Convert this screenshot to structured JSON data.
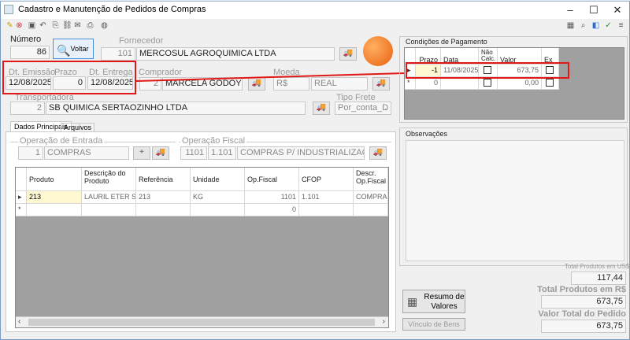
{
  "window": {
    "title": "Cadastro e Manutenção de Pedidos de Compras",
    "min": "–",
    "max": "☐",
    "close": "✕"
  },
  "header": {
    "numero_label": "Número",
    "numero_value": "86",
    "voltar_label": "Voltar",
    "fornecedor_label": "Fornecedor",
    "fornecedor_code": "101",
    "fornecedor_name": "MERCOSUL AGROQUIMICA LTDA",
    "dt_emissao_label": "Dt. Emissão",
    "dt_emissao_value": "12/08/2025",
    "prazo_label": "Prazo",
    "prazo_value": "0",
    "dt_entrega_label": "Dt. Entrega",
    "dt_entrega_value": "12/08/2025",
    "comprador_label": "Comprador",
    "comprador_code": "2",
    "comprador_name": "MARCELA GODOY",
    "moeda_label": "Moeda",
    "moeda_code": "R$",
    "moeda_name": "REAL",
    "transportadora_label": "Transportadora",
    "transportadora_code": "2",
    "transportadora_name": "SB QUIMICA SERTAOZINHO LTDA",
    "tipo_frete_label": "Tipo Frete",
    "tipo_frete_value": "Por_conta_D"
  },
  "tabs": [
    {
      "label": "Dados Principais"
    },
    {
      "label": "Arquivos"
    }
  ],
  "operacoes": {
    "entrada_label": "Operação de Entrada",
    "entrada_code": "1",
    "entrada_name": "COMPRAS",
    "fiscal_label": "Operação Fiscal",
    "fiscal_code": "1101",
    "fiscal_num": "1.101",
    "fiscal_name": "COMPRAS P/ INDUSTRIALIZACAO"
  },
  "items_grid": {
    "headers": [
      "Produto",
      "Descrição do Produto",
      "Referência",
      "Unidade",
      "Op.Fiscal",
      "CFOP",
      "Descr. Op.Fiscal"
    ],
    "rows": [
      [
        "213",
        "LAURIL ETER S...",
        "213",
        "KG",
        "1101",
        "1.101",
        "COMPRAS P..."
      ],
      [
        "",
        "",
        "",
        "",
        "0",
        "",
        ""
      ]
    ]
  },
  "pagamento": {
    "title": "Condições de Pagamento",
    "headers": [
      "Prazo",
      "Data",
      "Não Calc.",
      "Valor",
      "Ex"
    ],
    "rows": [
      [
        "-1",
        "11/08/2025",
        "",
        "673,75",
        ""
      ],
      [
        "0",
        "",
        "",
        "0,00",
        ""
      ]
    ]
  },
  "observacoes": {
    "title": "Observações"
  },
  "totais": {
    "us_label": "Total Produtos em US$",
    "us_value": "117,44",
    "rs_label": "Total Produtos em R$",
    "rs_value": "673,75",
    "pedido_label": "Valor Total do Pedido",
    "pedido_value": "673,75",
    "resumo_label": "Resumo de Valores",
    "vinculo_label": "Vínculo de Bens"
  },
  "colors": {
    "accent": "#e01818",
    "orange": "#f07a1a"
  }
}
